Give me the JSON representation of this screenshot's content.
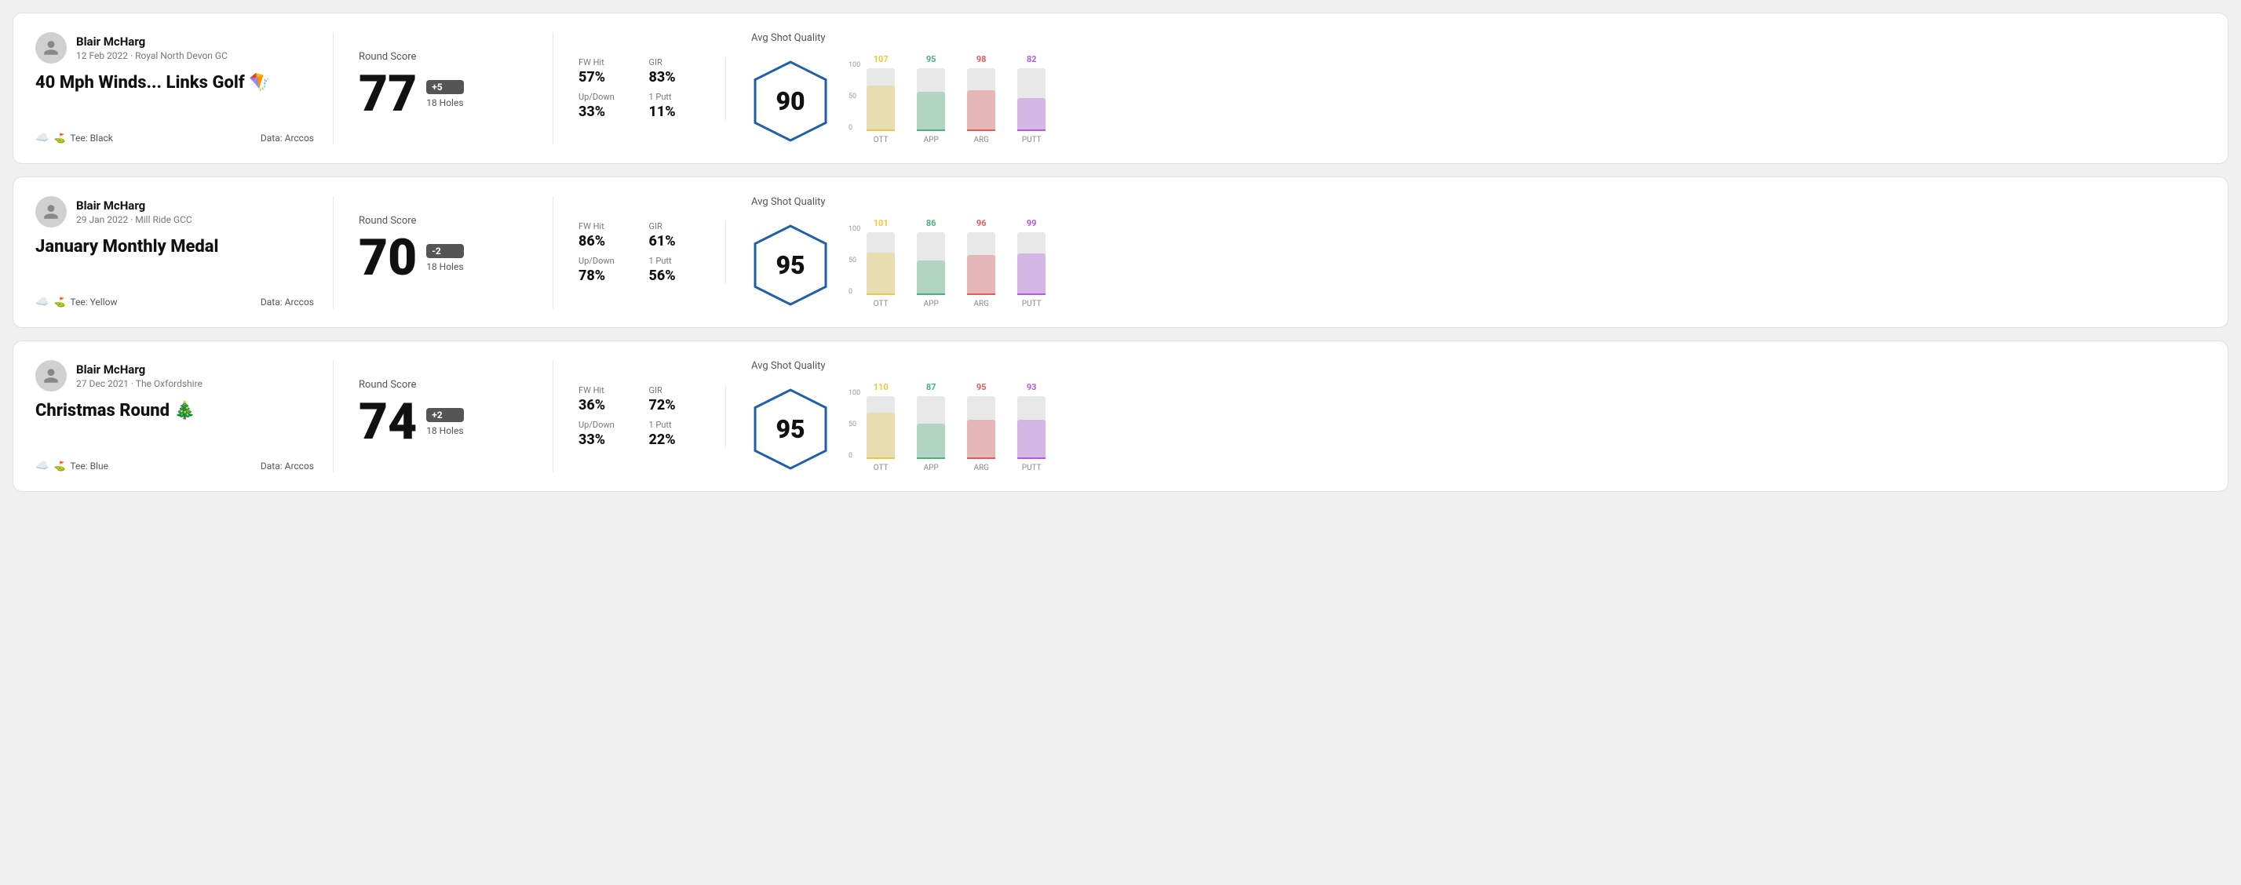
{
  "rounds": [
    {
      "id": "round1",
      "player": {
        "name": "Blair McHarg",
        "date": "12 Feb 2022 · Royal North Devon GC"
      },
      "title": "40 Mph Winds... Links Golf 🪁",
      "tee": "Black",
      "data_source": "Data: Arccos",
      "score": "77",
      "score_badge": "+5",
      "holes": "18 Holes",
      "fw_hit": "57%",
      "gir": "83%",
      "up_down": "33%",
      "one_putt": "11%",
      "avg_shot_quality": "90",
      "chart": {
        "ott": {
          "value": 107,
          "color": "#e8c84a",
          "bar_pct": 72
        },
        "app": {
          "value": 95,
          "color": "#4caf7d",
          "bar_pct": 62
        },
        "arg": {
          "value": 98,
          "color": "#e05b5b",
          "bar_pct": 65
        },
        "putt": {
          "value": 82,
          "color": "#b05be0",
          "bar_pct": 52
        }
      }
    },
    {
      "id": "round2",
      "player": {
        "name": "Blair McHarg",
        "date": "29 Jan 2022 · Mill Ride GCC"
      },
      "title": "January Monthly Medal",
      "tee": "Yellow",
      "data_source": "Data: Arccos",
      "score": "70",
      "score_badge": "-2",
      "holes": "18 Holes",
      "fw_hit": "86%",
      "gir": "61%",
      "up_down": "78%",
      "one_putt": "56%",
      "avg_shot_quality": "95",
      "chart": {
        "ott": {
          "value": 101,
          "color": "#e8c84a",
          "bar_pct": 68
        },
        "app": {
          "value": 86,
          "color": "#4caf7d",
          "bar_pct": 55
        },
        "arg": {
          "value": 96,
          "color": "#e05b5b",
          "bar_pct": 64
        },
        "putt": {
          "value": 99,
          "color": "#b05be0",
          "bar_pct": 66
        }
      }
    },
    {
      "id": "round3",
      "player": {
        "name": "Blair McHarg",
        "date": "27 Dec 2021 · The Oxfordshire"
      },
      "title": "Christmas Round 🎄",
      "tee": "Blue",
      "data_source": "Data: Arccos",
      "score": "74",
      "score_badge": "+2",
      "holes": "18 Holes",
      "fw_hit": "36%",
      "gir": "72%",
      "up_down": "33%",
      "one_putt": "22%",
      "avg_shot_quality": "95",
      "chart": {
        "ott": {
          "value": 110,
          "color": "#e8c84a",
          "bar_pct": 74
        },
        "app": {
          "value": 87,
          "color": "#4caf7d",
          "bar_pct": 56
        },
        "arg": {
          "value": 95,
          "color": "#e05b5b",
          "bar_pct": 63
        },
        "putt": {
          "value": 93,
          "color": "#b05be0",
          "bar_pct": 62
        }
      }
    }
  ],
  "labels": {
    "round_score": "Round Score",
    "fw_hit": "FW Hit",
    "gir": "GIR",
    "up_down": "Up/Down",
    "one_putt": "1 Putt",
    "avg_shot_quality": "Avg Shot Quality",
    "tee_prefix": "Tee:",
    "ott": "OTT",
    "app": "APP",
    "arg": "ARG",
    "putt": "PUTT",
    "y_100": "100",
    "y_50": "50",
    "y_0": "0"
  }
}
